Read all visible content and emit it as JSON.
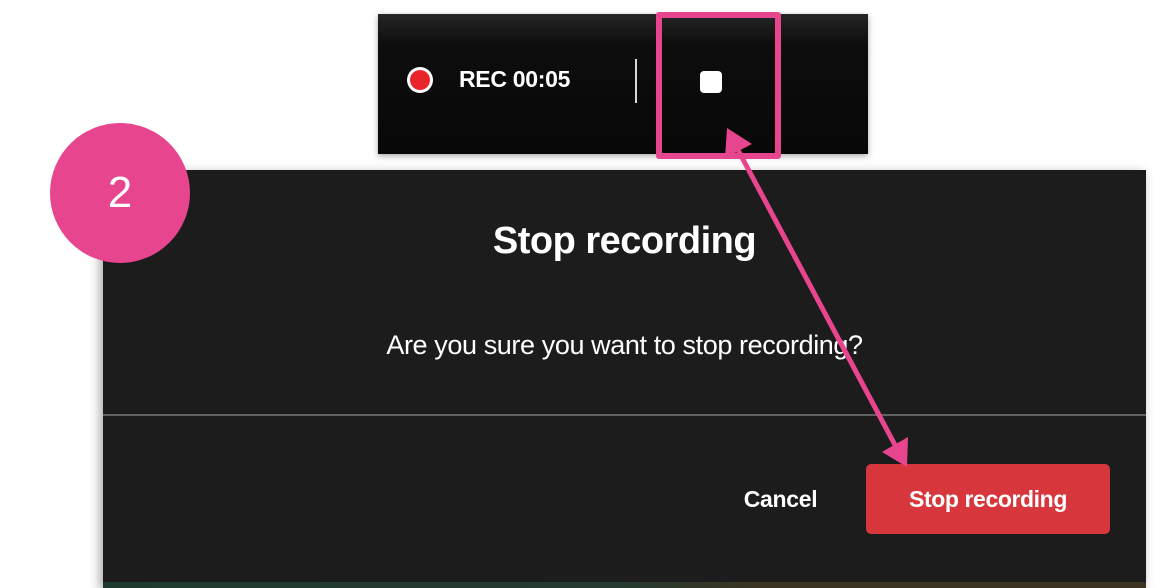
{
  "toolbar": {
    "timer_label": "REC 00:05",
    "record_indicator_icon": "record-dot-icon",
    "stop_icon": "stop-square-icon",
    "record_color": "#e8262a"
  },
  "dialog": {
    "title": "Stop recording",
    "message": "Are you sure you want to stop recording?",
    "cancel_label": "Cancel",
    "confirm_label": "Stop recording",
    "confirm_color": "#d6363c"
  },
  "annotation": {
    "step_number": "2",
    "highlight_color": "#e8458f",
    "arrow_icon": "double-headed-arrow"
  }
}
